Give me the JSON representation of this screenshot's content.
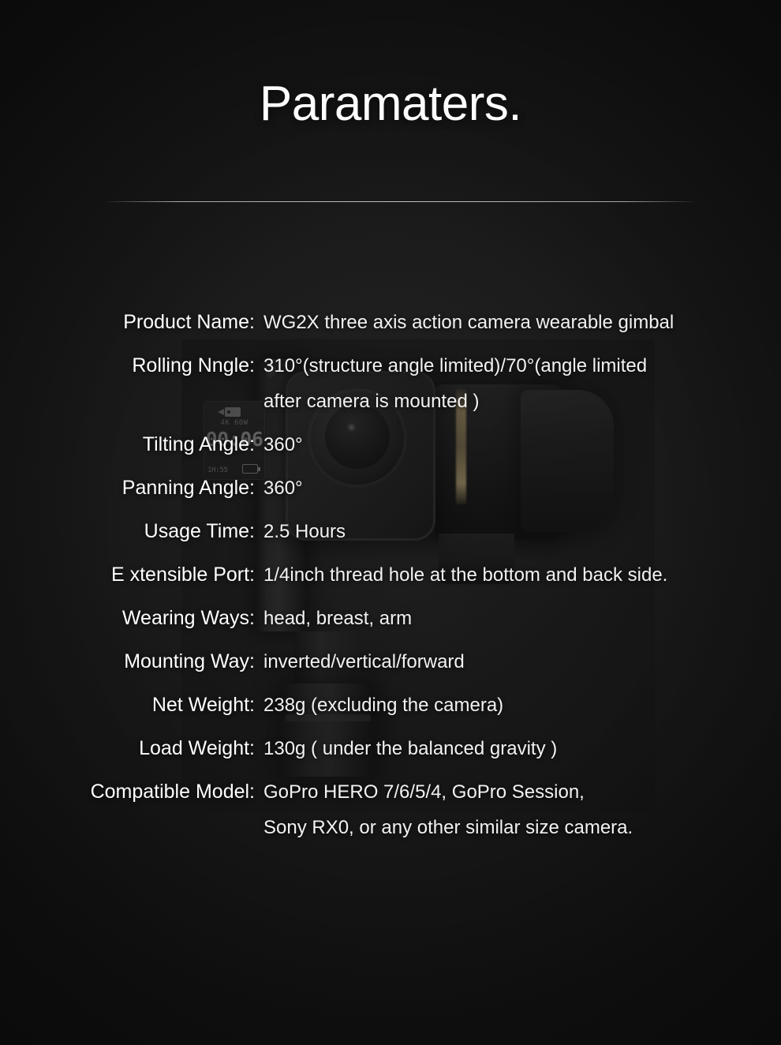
{
  "title": "Paramaters.",
  "colors": {
    "background": "#141414",
    "text": "#ffffff",
    "value_text": "#f2f2f2",
    "divider": "#e8e8e8",
    "gold_accent": "#bca470"
  },
  "product_photo": {
    "lcd": {
      "mode": "4K 60W",
      "recording_time": "00:06",
      "remaining": "1H:55"
    }
  },
  "specs": [
    {
      "label": "Product Name:",
      "value": "WG2X three axis action camera wearable gimbal"
    },
    {
      "label": "Rolling Nngle:",
      "value": "310°(structure angle limited)/70°(angle limited\nafter camera is mounted )"
    },
    {
      "label": "Tilting Angle:",
      "value": "360°"
    },
    {
      "label": "Panning Angle:",
      "value": "360°"
    },
    {
      "label": "Usage Time:",
      "value": "2.5 Hours"
    },
    {
      "label": "E xtensible Port:",
      "value": "1/4inch thread hole at the bottom and back side."
    },
    {
      "label": "Wearing Ways:",
      "value": "head, breast, arm"
    },
    {
      "label": "Mounting Way:",
      "value": "inverted/vertical/forward"
    },
    {
      "label": "Net Weight:",
      "value": " 238g (excluding the camera)"
    },
    {
      "label": "Load Weight:",
      "value": "130g ( under the balanced gravity )"
    },
    {
      "label": "Compatible Model:",
      "value": "GoPro HERO 7/6/5/4, GoPro Session,\nSony RX0, or any other similar size camera."
    }
  ]
}
